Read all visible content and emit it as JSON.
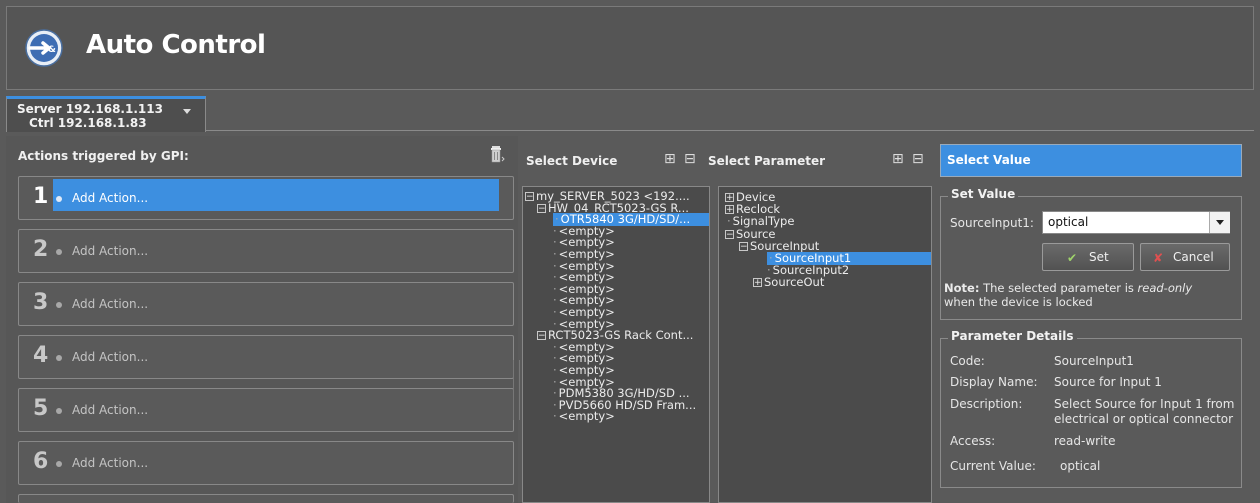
{
  "app": {
    "title": "Auto Control"
  },
  "tab": {
    "line1": "Server 192.168.1.113",
    "line2": "Ctrl 192.168.1.83"
  },
  "actions": {
    "title": "Actions triggered by GPI:",
    "items": [
      {
        "number": "1",
        "label": "Add Action..."
      },
      {
        "number": "2",
        "label": "Add Action..."
      },
      {
        "number": "3",
        "label": "Add Action..."
      },
      {
        "number": "4",
        "label": "Add Action..."
      },
      {
        "number": "5",
        "label": "Add Action..."
      },
      {
        "number": "6",
        "label": "Add Action..."
      }
    ]
  },
  "device": {
    "header": "Select Device",
    "tree": [
      {
        "text": "my_SERVER_5023 <192....",
        "expander": "−"
      },
      {
        "text": "HW_04_RCT5023-GS R...",
        "expander": "−"
      },
      {
        "text": "OTR5840 3G/HD/SD/...",
        "selected": true
      },
      {
        "text": "<empty>"
      },
      {
        "text": "<empty>"
      },
      {
        "text": "<empty>"
      },
      {
        "text": "<empty>"
      },
      {
        "text": "<empty>"
      },
      {
        "text": "<empty>"
      },
      {
        "text": "<empty>"
      },
      {
        "text": "<empty>"
      },
      {
        "text": "<empty>"
      },
      {
        "text": "RCT5023-GS Rack Cont...",
        "expander": "−"
      },
      {
        "text": "<empty>"
      },
      {
        "text": "<empty>"
      },
      {
        "text": "<empty>"
      },
      {
        "text": "<empty>"
      },
      {
        "text": "PDM5380 3G/HD/SD ..."
      },
      {
        "text": "PVD5660 HD/SD Fram..."
      },
      {
        "text": "<empty>"
      }
    ]
  },
  "parameter": {
    "header": "Select Parameter",
    "tree": [
      {
        "text": "Device",
        "expander": "+"
      },
      {
        "text": "Reclock",
        "expander": "+"
      },
      {
        "text": "SignalType"
      },
      {
        "text": "Source",
        "expander": "−"
      },
      {
        "text": "SourceInput",
        "expander": "−"
      },
      {
        "text": "SourceInput1",
        "selected": true
      },
      {
        "text": "SourceInput2"
      },
      {
        "text": "SourceOut",
        "expander": "+"
      }
    ]
  },
  "value": {
    "header": "Select Value",
    "set_title": "Set Value",
    "field_label": "SourceInput1:",
    "field_value": "optical",
    "set_label": "Set",
    "cancel_label": "Cancel",
    "note_bold": "Note:",
    "note_text": " The selected parameter is ",
    "note_italic": "read-only",
    "note_line2": "when the device is locked"
  },
  "details": {
    "title": "Parameter Details",
    "code_label": "Code:",
    "code_value": "SourceInput1",
    "display_label": "Display Name:",
    "display_value": "Source for Input 1",
    "description_label": "Description:",
    "description_value_1": "Select Source for Input 1 from",
    "description_value_2": "electrical or optical connector",
    "access_label": "Access:",
    "access_value": "read-write",
    "current_label": "Current Value:",
    "current_value": "optical"
  },
  "colors": {
    "accent": "#3d8fe0",
    "background": "#5a5a5a"
  },
  "icons": [
    "logo-icon",
    "trash-icon",
    "expand-all-icon",
    "collapse-all-icon",
    "checkmark-icon",
    "cancel-x-icon"
  ]
}
